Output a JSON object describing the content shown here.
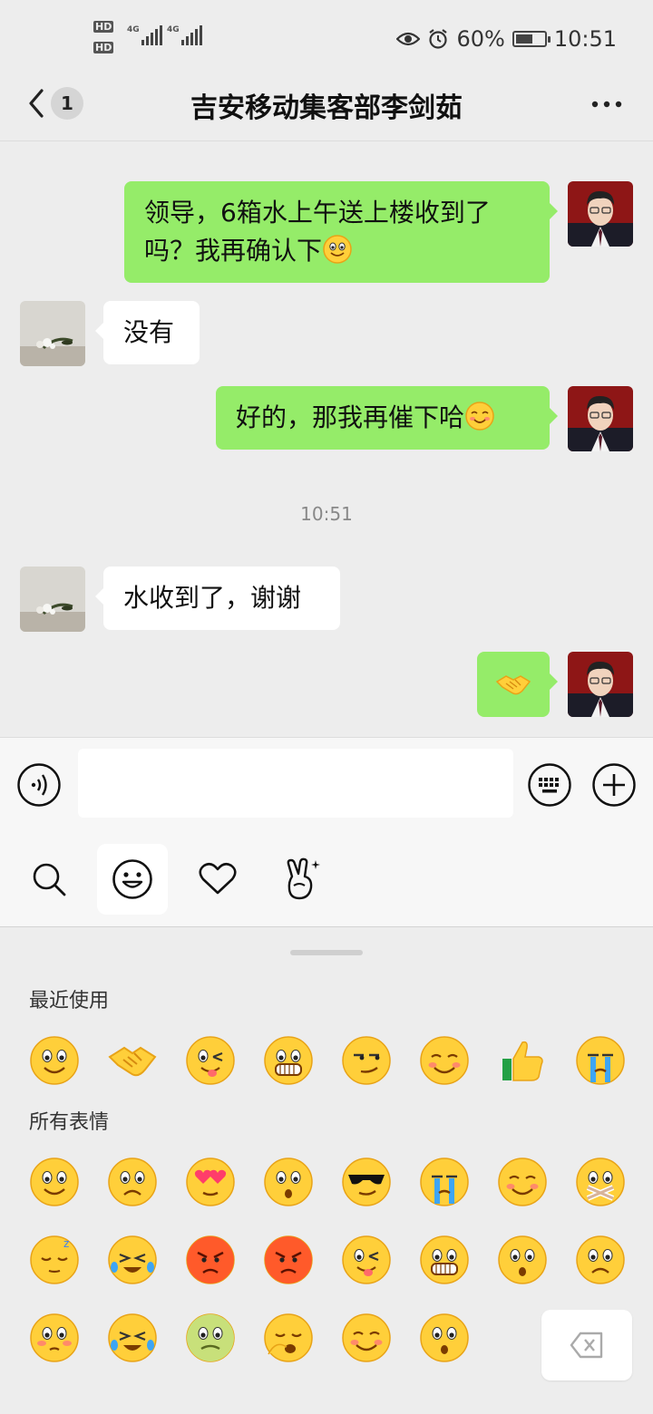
{
  "status_bar": {
    "hd1": "HD",
    "hd2": "HD",
    "net1": "4G",
    "net2": "4G",
    "battery_text": "60%",
    "battery_level": 0.6,
    "time": "10:51",
    "icons": [
      "eye-icon",
      "alarm-icon",
      "battery-icon",
      "signal-icon"
    ]
  },
  "header": {
    "title": "吉安移动集客部李剑茹",
    "unread_badge": "1",
    "icons": [
      "back-chevron-icon",
      "more-dots-icon"
    ]
  },
  "messages": [
    {
      "side": "out",
      "text": "领导，6箱水上午送上楼收到了吗？我再确认下",
      "emoji": "smile-face-icon"
    },
    {
      "side": "in",
      "text": "没有"
    },
    {
      "side": "out",
      "text": "好的，那我再催下哈",
      "emoji": "blush-face-icon"
    },
    {
      "side": "time",
      "text": "10:51"
    },
    {
      "side": "in",
      "text": "水收到了，谢谢"
    },
    {
      "side": "out",
      "emoji": "handshake-icon"
    }
  ],
  "input_bar": {
    "value": "",
    "icons": [
      "voice-icon",
      "keyboard-icon",
      "plus-icon"
    ]
  },
  "sticker_tabs": {
    "items": [
      "search-icon",
      "emoji-face-icon",
      "heart-icon",
      "gesture-icon"
    ],
    "active": 1
  },
  "emoji_panel": {
    "recent_label": "最近使用",
    "all_label": "所有表情",
    "recent": [
      "smile",
      "handshake",
      "tongue-wink",
      "grin",
      "smirk",
      "grateful",
      "thumbs-up",
      "cry"
    ],
    "all_rows": [
      [
        "smile",
        "worried",
        "heart-eyes",
        "shocked",
        "cool",
        "cry",
        "shy",
        "silent"
      ],
      [
        "sleep",
        "tears",
        "angry",
        "furious",
        "tongue-wink",
        "grin",
        "surprised",
        "sad"
      ],
      [
        "embarrassed",
        "laugh-cry",
        "sick",
        "yawn",
        "blush",
        "wow"
      ]
    ],
    "colors": {
      "face": "#ffcf3a",
      "face_edge": "#e8a317",
      "bubble_out": "#95ec69"
    }
  }
}
